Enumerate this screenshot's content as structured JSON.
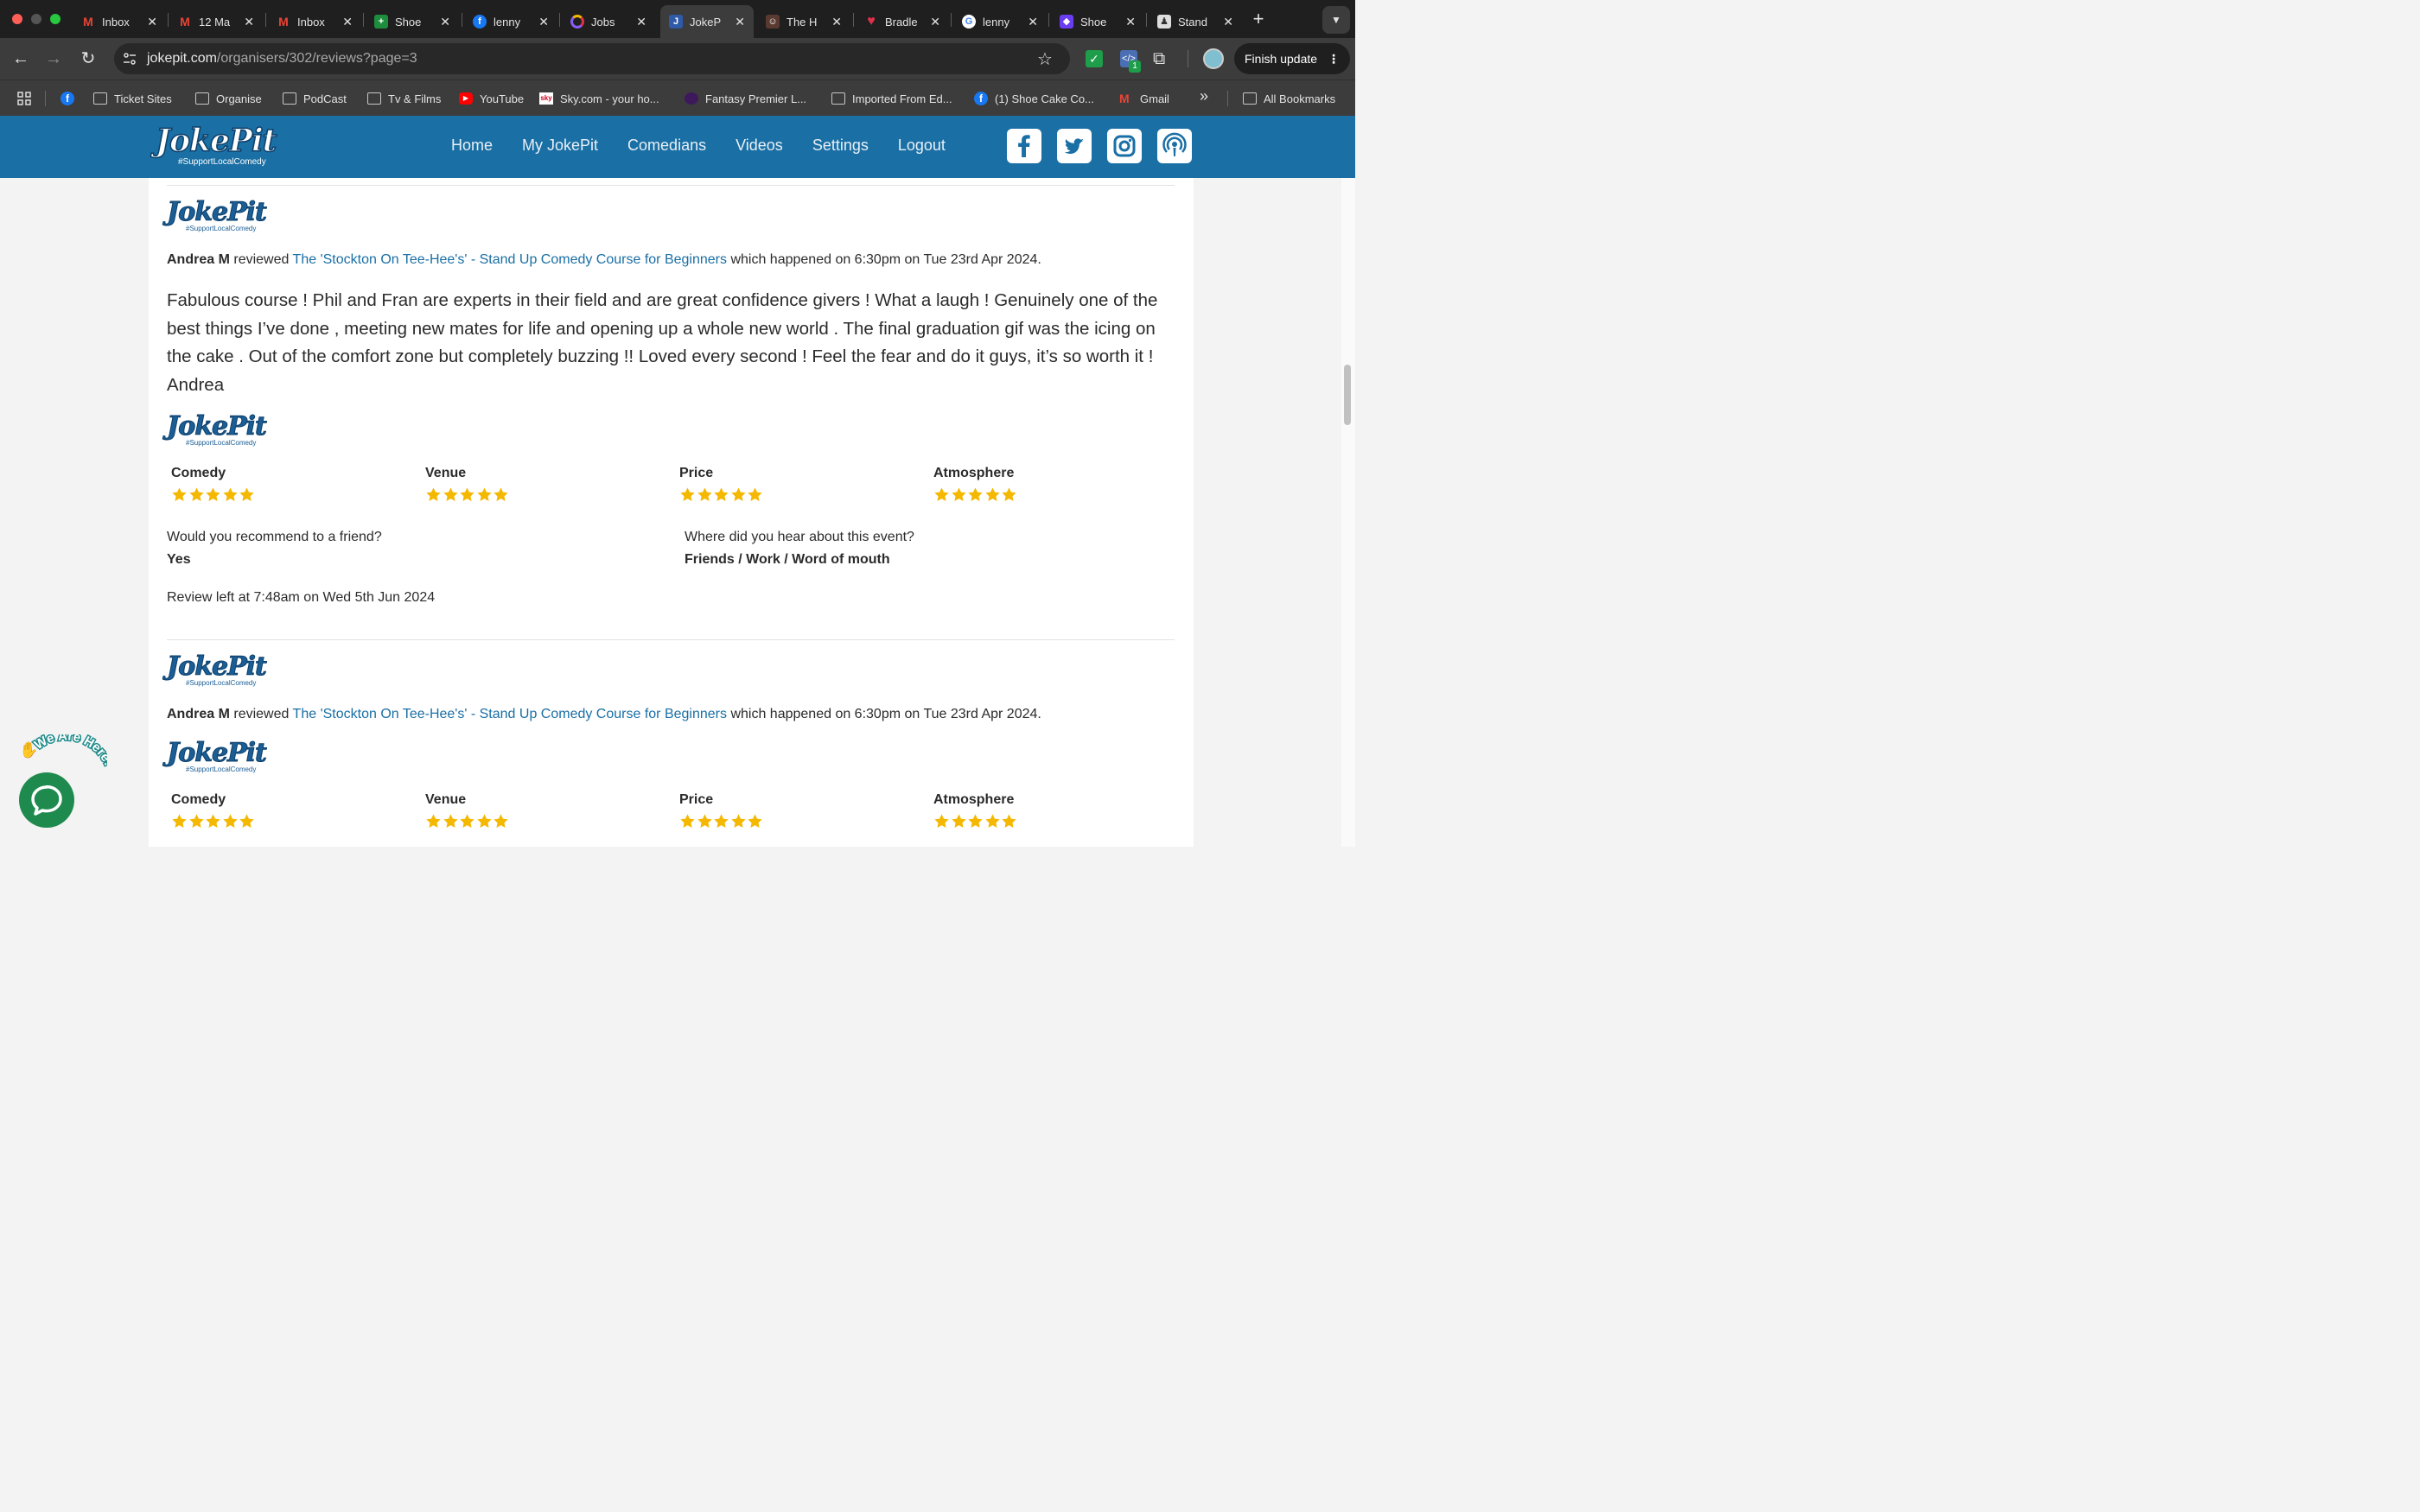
{
  "browser": {
    "tabs": [
      {
        "title": "Inbox",
        "icon": "gmail-icon",
        "color": "#ea4335"
      },
      {
        "title": "12 Ma",
        "icon": "gmail-icon",
        "color": "#ea4335"
      },
      {
        "title": "Inbox",
        "icon": "gmail-icon",
        "color": "#ea4335"
      },
      {
        "title": "Shoe",
        "icon": "sheets-icon",
        "color": "#1e8e3e"
      },
      {
        "title": "lenny",
        "icon": "facebook-icon",
        "color": "#1877f2"
      },
      {
        "title": "Jobs",
        "icon": "ring-icon",
        "color": "#9b59b6"
      },
      {
        "title": "JokeP",
        "icon": "jokepit-icon",
        "color": "#2e5aa8"
      },
      {
        "title": "The H",
        "icon": "people-icon",
        "color": "#7a4a3a"
      },
      {
        "title": "Bradle",
        "icon": "heart-icon",
        "color": "#e0304b"
      },
      {
        "title": "lenny",
        "icon": "google-icon",
        "color": "#4285f4"
      },
      {
        "title": "Shoe",
        "icon": "cube-icon",
        "color": "#6a3df0"
      },
      {
        "title": "Stand",
        "icon": "standup-icon",
        "color": "#888888"
      }
    ],
    "active_tab_index": 6,
    "new_tab_label": "+",
    "url_host": "jokepit.com",
    "url_path": "/organisers/302/reviews?page=3",
    "finish_update_label": "Finish update",
    "extension_badge": "1",
    "bookmarks": [
      {
        "label": "",
        "icon": "facebook-icon"
      },
      {
        "label": "Ticket Sites",
        "icon": "folder-icon"
      },
      {
        "label": "Organise",
        "icon": "folder-icon"
      },
      {
        "label": "PodCast",
        "icon": "folder-icon"
      },
      {
        "label": "Tv & Films",
        "icon": "folder-icon"
      },
      {
        "label": "YouTube",
        "icon": "youtube-icon"
      },
      {
        "label": "Sky.com - your ho...",
        "icon": "sky-icon"
      },
      {
        "label": "Fantasy Premier L...",
        "icon": "premier-league-icon"
      },
      {
        "label": "Imported From Ed...",
        "icon": "folder-icon"
      },
      {
        "label": "(1) Shoe Cake Co...",
        "icon": "facebook-icon"
      },
      {
        "label": "Gmail",
        "icon": "gmail-icon"
      }
    ],
    "bookmarks_overflow": "»",
    "all_bookmarks_label": "All Bookmarks"
  },
  "site": {
    "logo_text": "JokePit",
    "logo_tagline": "#SupportLocalComedy",
    "nav": [
      "Home",
      "My JokePit",
      "Comedians",
      "Videos",
      "Settings",
      "Logout"
    ],
    "social": [
      "facebook-icon",
      "twitter-icon",
      "instagram-icon",
      "podcast-icon"
    ],
    "brand_color": "#1a6fa5"
  },
  "reviews": [
    {
      "reviewer": "Andrea M",
      "verb": "reviewed",
      "event": "The 'Stockton On Tee-Hee's' - Stand Up Comedy Course for Beginners",
      "happened": "which happened on 6:30pm on Tue 23rd Apr 2024.",
      "text": "Fabulous course ! Phil and Fran are experts in their field and are great confidence givers ! What a laugh ! Genuinely one of the best things I’ve done , meeting new mates for life and opening up a whole new world . The final graduation gif was the icing on the cake . Out of the comfort zone but completely buzzing !! Loved every second ! Feel the fear and do it guys, it’s so worth it ! Andrea",
      "ratings": [
        {
          "label": "Comedy",
          "stars": 5
        },
        {
          "label": "Venue",
          "stars": 5
        },
        {
          "label": "Price",
          "stars": 5
        },
        {
          "label": "Atmosphere",
          "stars": 5
        }
      ],
      "recommend_question": "Would you recommend to a friend?",
      "recommend_answer": "Yes",
      "hear_question": "Where did you hear about this event?",
      "hear_answer": "Friends / Work / Word of mouth",
      "left_at": "Review left at 7:48am on Wed 5th Jun 2024"
    },
    {
      "reviewer": "Andrea M",
      "verb": "reviewed",
      "event": "The 'Stockton On Tee-Hee's' - Stand Up Comedy Course for Beginners",
      "happened": "which happened on 6:30pm on Tue 23rd Apr 2024.",
      "ratings": [
        {
          "label": "Comedy",
          "stars": 5
        },
        {
          "label": "Venue",
          "stars": 5
        },
        {
          "label": "Price",
          "stars": 5
        },
        {
          "label": "Atmosphere",
          "stars": 5
        }
      ]
    }
  ],
  "chat_widget": {
    "label": "We Are Here!",
    "emoji": "✋"
  },
  "star_color": "#f5b800"
}
